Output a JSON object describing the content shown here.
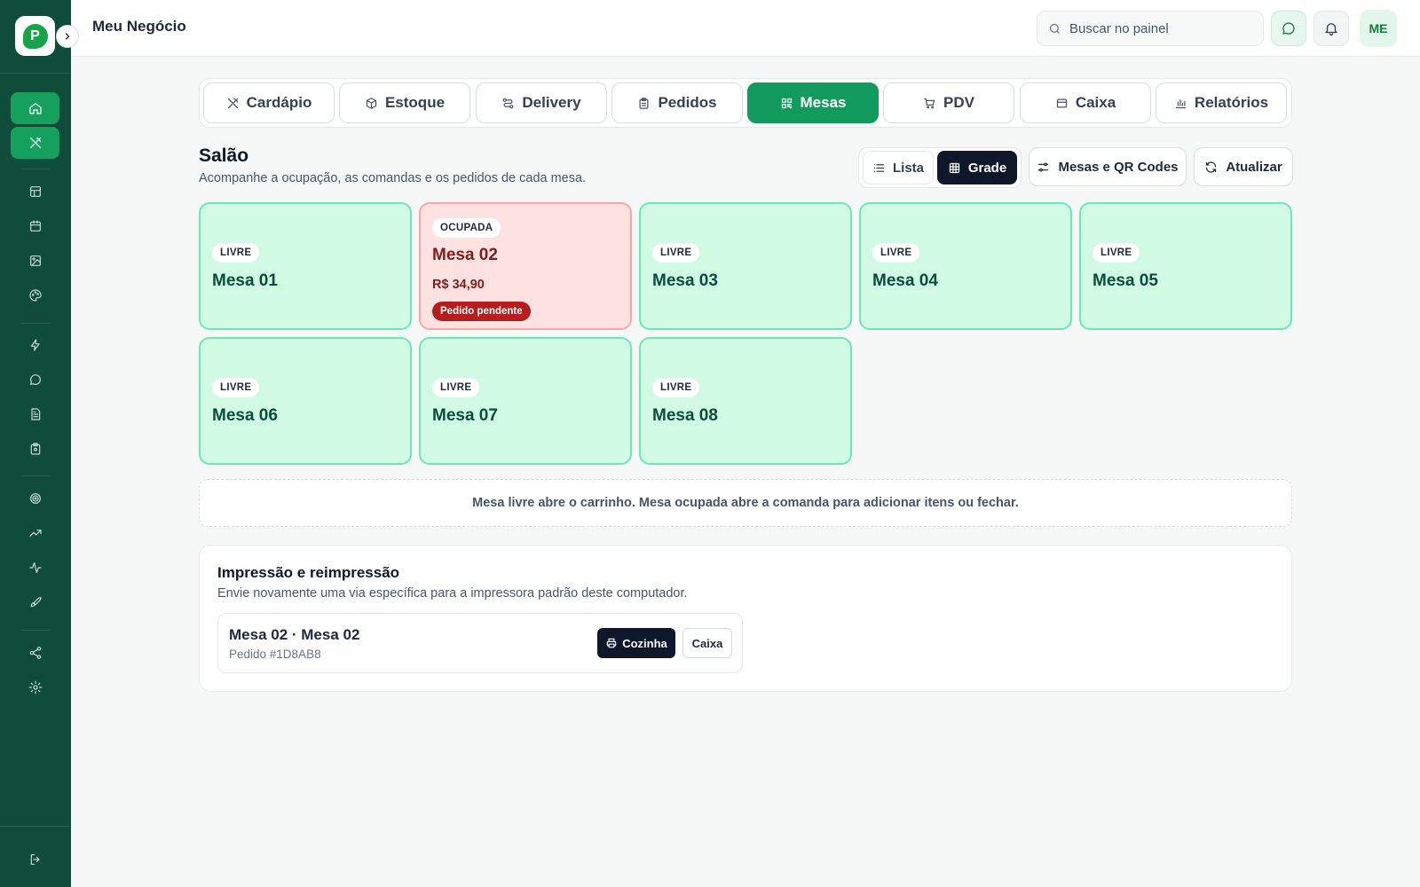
{
  "header": {
    "title": "Meu Negócio",
    "search_placeholder": "Buscar no painel",
    "avatar_initials": "ME"
  },
  "sidebar": {
    "items": [
      {
        "icon": "home-icon",
        "active": true
      },
      {
        "icon": "utensils-icon",
        "active": true
      },
      {
        "icon": "layout-icon",
        "active": false
      },
      {
        "icon": "calendar-icon",
        "active": false
      },
      {
        "icon": "image-icon",
        "active": false
      },
      {
        "icon": "palette-icon",
        "active": false
      },
      {
        "icon": "zap-icon",
        "active": false
      },
      {
        "icon": "message-icon",
        "active": false
      },
      {
        "icon": "file-icon",
        "active": false
      },
      {
        "icon": "clipboard-icon",
        "active": false
      },
      {
        "icon": "target-icon",
        "active": false
      },
      {
        "icon": "trending-up-icon",
        "active": false
      },
      {
        "icon": "activity-icon",
        "active": false
      },
      {
        "icon": "rocket-icon",
        "active": false
      },
      {
        "icon": "share-icon",
        "active": false
      },
      {
        "icon": "settings-icon",
        "active": false
      },
      {
        "icon": "logout-icon",
        "active": false
      }
    ]
  },
  "tabs": [
    {
      "label": "Cardápio",
      "icon": "utensils-icon",
      "active": false
    },
    {
      "label": "Estoque",
      "icon": "box-icon",
      "active": false
    },
    {
      "label": "Delivery",
      "icon": "route-icon",
      "active": false
    },
    {
      "label": "Pedidos",
      "icon": "clipboard-icon",
      "active": false
    },
    {
      "label": "Mesas",
      "icon": "qr-icon",
      "active": true
    },
    {
      "label": "PDV",
      "icon": "cart-icon",
      "active": false
    },
    {
      "label": "Caixa",
      "icon": "wallet-icon",
      "active": false
    },
    {
      "label": "Relatórios",
      "icon": "bar-chart-icon",
      "active": false
    }
  ],
  "section": {
    "title": "Salão",
    "subtitle": "Acompanhe a ocupação, as comandas e os pedidos de cada mesa.",
    "view_list": "Lista",
    "view_grid": "Grade",
    "btn_qr": "Mesas e QR Codes",
    "btn_refresh": "Atualizar"
  },
  "tables": [
    {
      "status": "LIVRE",
      "name": "Mesa 01"
    },
    {
      "status": "OCUPADA",
      "name": "Mesa 02",
      "amount": "R$ 34,90",
      "tag": "Pedido pendente"
    },
    {
      "status": "LIVRE",
      "name": "Mesa 03"
    },
    {
      "status": "LIVRE",
      "name": "Mesa 04"
    },
    {
      "status": "LIVRE",
      "name": "Mesa 05"
    },
    {
      "status": "LIVRE",
      "name": "Mesa 06"
    },
    {
      "status": "LIVRE",
      "name": "Mesa 07"
    },
    {
      "status": "LIVRE",
      "name": "Mesa 08"
    }
  ],
  "hint": "Mesa livre abre o carrinho. Mesa ocupada abre a comanda para adicionar itens ou fechar.",
  "print": {
    "title": "Impressão e reimpressão",
    "subtitle": "Envie novamente uma via específica para a impressora padrão deste computador.",
    "row": {
      "title": "Mesa 02 · Mesa 02",
      "order": "Pedido #1D8AB8",
      "btn_kitchen": "Cozinha",
      "btn_cashier": "Caixa"
    }
  },
  "colors": {
    "sidebar_bg": "#0f4c3a",
    "accent": "#129a5f",
    "free_card": "#d1fae5",
    "occupied_card": "#fee2e2",
    "pending_badge": "#b91c1c"
  }
}
